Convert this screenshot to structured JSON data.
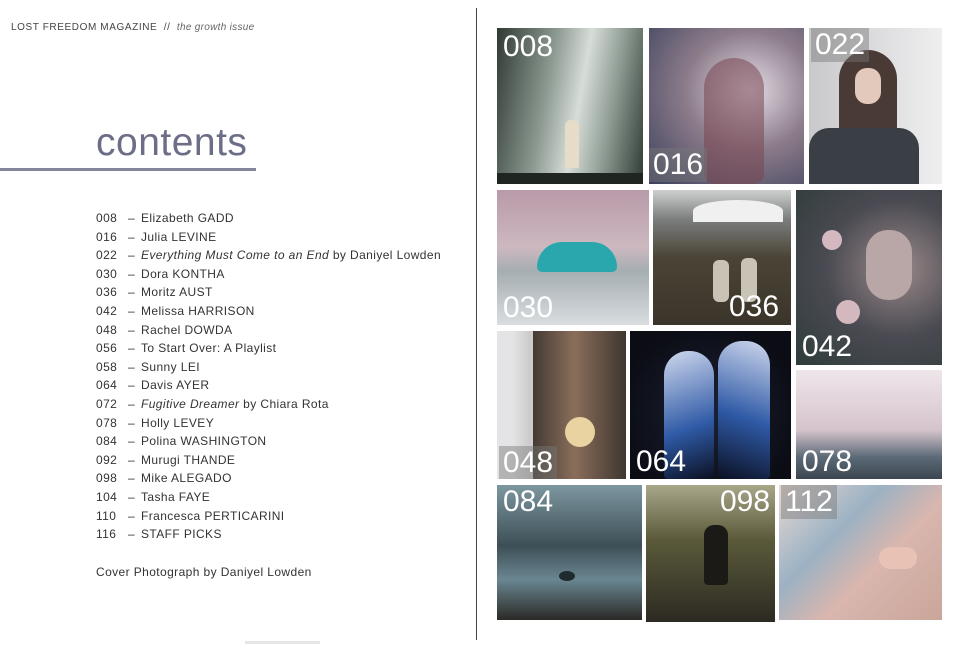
{
  "masthead": {
    "magazine": "LOST FREEDOM MAGAZINE",
    "separator": "//",
    "issue": "the growth issue"
  },
  "heading": "contents",
  "toc": [
    {
      "page": "008",
      "parts": [
        {
          "t": "Elizabeth GADD",
          "i": false
        }
      ]
    },
    {
      "page": "016",
      "parts": [
        {
          "t": "Julia LEVINE",
          "i": false
        }
      ]
    },
    {
      "page": "022",
      "parts": [
        {
          "t": "Everything Must Come to an End",
          "i": true
        },
        {
          "t": " by Daniyel Lowden",
          "i": false
        }
      ]
    },
    {
      "page": "030",
      "parts": [
        {
          "t": "Dora KONTHA",
          "i": false
        }
      ]
    },
    {
      "page": "036",
      "parts": [
        {
          "t": "Moritz AUST",
          "i": false
        }
      ]
    },
    {
      "page": "042",
      "parts": [
        {
          "t": "Melissa HARRISON",
          "i": false
        }
      ]
    },
    {
      "page": "048",
      "parts": [
        {
          "t": "Rachel DOWDA",
          "i": false
        }
      ]
    },
    {
      "page": "056",
      "parts": [
        {
          "t": "To Start Over: A Playlist",
          "i": false
        }
      ]
    },
    {
      "page": "058",
      "parts": [
        {
          "t": "Sunny LEI",
          "i": false
        }
      ]
    },
    {
      "page": "064",
      "parts": [
        {
          "t": "Davis AYER",
          "i": false
        }
      ]
    },
    {
      "page": "072",
      "parts": [
        {
          "t": "Fugitive Dreamer",
          "i": true
        },
        {
          "t": " by Chiara Rota",
          "i": false
        }
      ]
    },
    {
      "page": "078",
      "parts": [
        {
          "t": "Holly LEVEY",
          "i": false
        }
      ]
    },
    {
      "page": "084",
      "parts": [
        {
          "t": "Polina WASHINGTON",
          "i": false
        }
      ]
    },
    {
      "page": "092",
      "parts": [
        {
          "t": "Murugi THANDE",
          "i": false
        }
      ]
    },
    {
      "page": "098",
      "parts": [
        {
          "t": "Mike ALEGADO",
          "i": false
        }
      ]
    },
    {
      "page": "104",
      "parts": [
        {
          "t": "Tasha FAYE",
          "i": false
        }
      ]
    },
    {
      "page": "110",
      "parts": [
        {
          "t": "Francesca PERTICARINI",
          "i": false
        }
      ]
    },
    {
      "page": "116",
      "parts": [
        {
          "t": "STAFF PICKS",
          "i": false
        }
      ]
    }
  ],
  "cover_credit": "Cover Photograph by Daniyel Lowden",
  "photos": [
    {
      "label": "008",
      "scene": "waterfall-figure",
      "colors": [
        "#2f3a33",
        "#8c9a92",
        "#d7ddd8"
      ]
    },
    {
      "label": "016",
      "scene": "double-exposure-woman",
      "colors": [
        "#3a3f5c",
        "#8c7c8a",
        "#e4dde6"
      ]
    },
    {
      "label": "022",
      "scene": "portrait-woman",
      "colors": [
        "#c9c9cc",
        "#4a3a36",
        "#efeff0"
      ]
    },
    {
      "label": "030",
      "scene": "glacier-ice",
      "colors": [
        "#b89aa8",
        "#2aa7ad",
        "#a5aeb2"
      ]
    },
    {
      "label": "036",
      "scene": "couple-landscape",
      "colors": [
        "#4b4436",
        "#7a7d7d",
        "#c8c3b5"
      ]
    },
    {
      "label": "042",
      "scene": "woman-roses",
      "colors": [
        "#2e3c3a",
        "#9a8a8a",
        "#d3b9bf"
      ]
    },
    {
      "label": "048",
      "scene": "interior-room",
      "colors": [
        "#3e3630",
        "#d7d7d9",
        "#8a6e5a"
      ]
    },
    {
      "label": "064",
      "scene": "galaxy-couple",
      "colors": [
        "#0b0c14",
        "#2f5aa6",
        "#cfd8ee"
      ]
    },
    {
      "label": "078",
      "scene": "pink-sky-coast",
      "colors": [
        "#d6c4cc",
        "#5b6a77",
        "#eee6ea"
      ]
    },
    {
      "label": "084",
      "scene": "misty-forest-river",
      "colors": [
        "#3d4f56",
        "#7d97a0",
        "#2a2a26"
      ]
    },
    {
      "label": "098",
      "scene": "figure-field",
      "colors": [
        "#5a5a3a",
        "#2c2a22",
        "#a9a68a"
      ]
    },
    {
      "label": "112",
      "scene": "hands-map",
      "colors": [
        "#d9b6ae",
        "#9cb2c4",
        "#e8d9d2"
      ]
    }
  ]
}
